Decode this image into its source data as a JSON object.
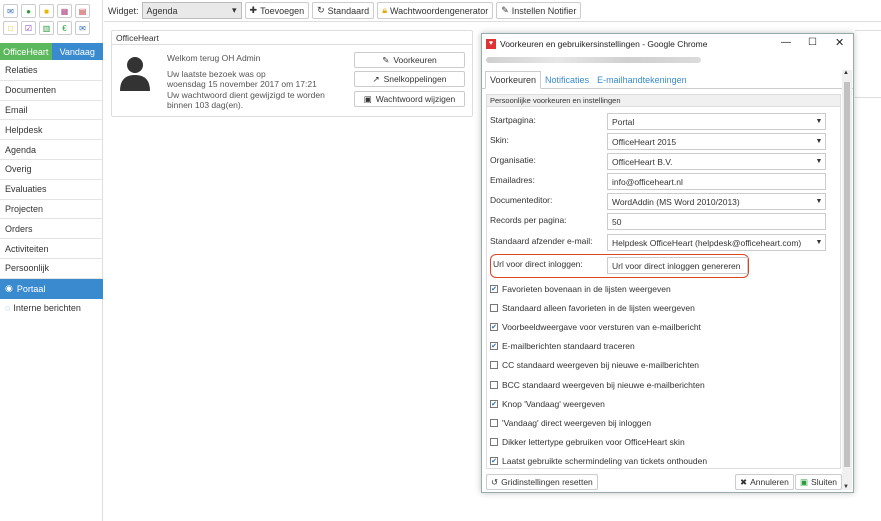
{
  "sidebar": {
    "tab_officeheart": "OfficeHeart",
    "tab_today": "Vandaag",
    "nav": [
      "Relaties",
      "Documenten",
      "Email",
      "Helpdesk",
      "Agenda",
      "Overig",
      "Evaluaties",
      "Projecten",
      "Orders",
      "Activiteiten",
      "Persoonlijk",
      "Portaal"
    ],
    "sub_item": "Interne berichten"
  },
  "toolbar": {
    "widget_label": "Widget:",
    "widget_value": "Agenda",
    "add": "Toevoegen",
    "default": "Standaard",
    "password_gen": "Wachtwoordengenerator",
    "notifier": "Instellen Notifier"
  },
  "panel": {
    "title": "OfficeHeart",
    "welcome": "Welkom terug OH Admin",
    "visit1": "Uw laatste bezoek was op",
    "visit2": "woensdag 15 november 2017 om 17:21",
    "pw1": "Uw wachtwoord dient gewijzigd te worden",
    "pw2": "binnen 103 dag(en).",
    "btn_prefs": "Voorkeuren",
    "btn_shortcuts": "Snelkoppelingen",
    "btn_password": "Wachtwoord wijzigen"
  },
  "dialog": {
    "title": "Voorkeuren en gebruikersinstellingen - Google Chrome",
    "tabs": [
      "Voorkeuren",
      "Notificaties",
      "E-mailhandtekeningen"
    ],
    "section": "Persoonlijke voorkeuren en instellingen",
    "fields": {
      "start": {
        "label": "Startpagina:",
        "value": "Portal"
      },
      "skin": {
        "label": "Skin:",
        "value": "OfficeHeart 2015"
      },
      "org": {
        "label": "Organisatie:",
        "value": "OfficeHeart B.V."
      },
      "email": {
        "label": "Emailadres:",
        "value": "info@officeheart.nl"
      },
      "editor": {
        "label": "Documenteditor:",
        "value": "WordAddin (MS Word 2010/2013)"
      },
      "records": {
        "label": "Records per pagina:",
        "value": "50"
      },
      "sender": {
        "label": "Standaard afzender e-mail:",
        "value": "Helpdesk OfficeHeart (helpdesk@officeheart.com)"
      }
    },
    "direct_login": {
      "label": "Url voor direct inloggen:",
      "button": "Url voor direct inloggen genereren"
    },
    "checks": [
      {
        "label": "Favorieten bovenaan in de lijsten weergeven",
        "checked": true
      },
      {
        "label": "Standaard alleen favorieten in de lijsten weergeven",
        "checked": false
      },
      {
        "label": "Voorbeeldweergave voor versturen van e-mailbericht",
        "checked": true
      },
      {
        "label": "E-mailberichten standaard traceren",
        "checked": true
      },
      {
        "label": "CC standaard weergeven bij nieuwe e-mailberichten",
        "checked": false
      },
      {
        "label": "BCC standaard weergeven bij nieuwe e-mailberichten",
        "checked": false
      },
      {
        "label": "Knop 'Vandaag' weergeven",
        "checked": true
      },
      {
        "label": "'Vandaag' direct weergeven bij inloggen",
        "checked": false
      },
      {
        "label": "Dikker lettertype gebruiken voor OfficeHeart skin",
        "checked": false
      },
      {
        "label": "Laatst gebruikte schermindeling van tickets onthouden",
        "checked": true
      }
    ],
    "footer": {
      "reset": "Gridinstellingen resetten",
      "cancel": "Annuleren",
      "close": "Sluiten"
    }
  },
  "colors": {
    "accent_blue": "#3a8ad0",
    "accent_green": "#5cb85c",
    "highlight_red": "#dd4422"
  }
}
